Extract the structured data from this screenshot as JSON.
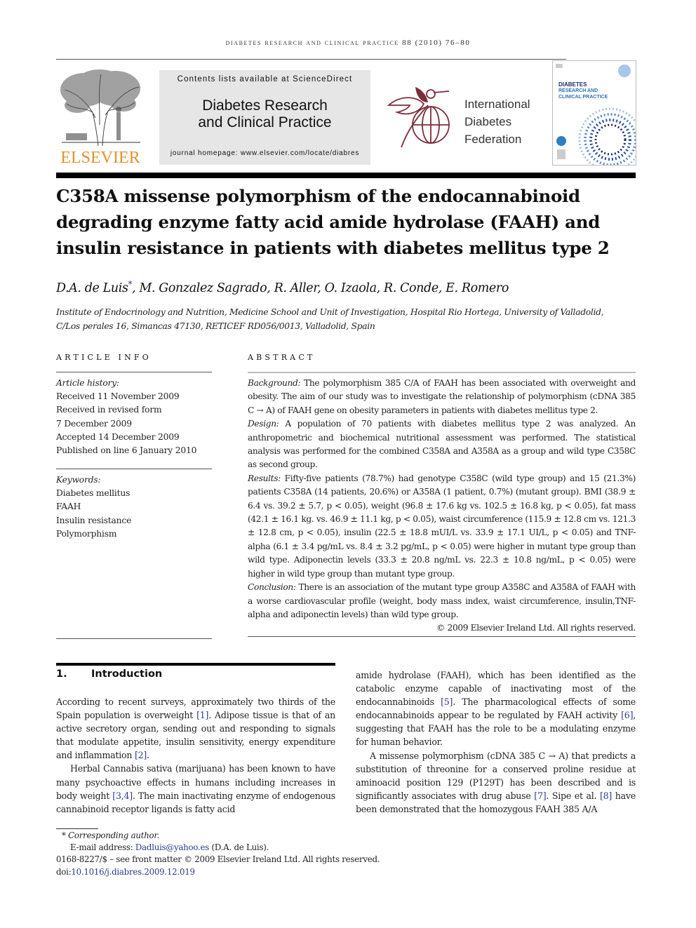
{
  "running_head": "DIABETES RESEARCH AND CLINICAL PRACTICE 88 (2010) 76–80",
  "masthead": {
    "publisher_logo": "ELSEVIER",
    "sciencedirect": "Contents lists available at ScienceDirect",
    "journal_title_line1": "Diabetes Research",
    "journal_title_line2": "and Clinical Practice",
    "homepage_label": "journal homepage: ",
    "homepage_url": "www.elsevier.com/locate/diabres",
    "idf_line1": "International",
    "idf_line2": "Diabetes",
    "idf_line3": "Federation",
    "cover_line1": "DIABETES",
    "cover_line2": "RESEARCH AND",
    "cover_line3": "CLINICAL PRACTICE"
  },
  "article": {
    "title": "C358A missense polymorphism of the endocannabinoid degrading enzyme fatty acid amide hydrolase (FAAH) and insulin resistance in patients with diabetes mellitus type 2",
    "first_author": "D.A. de Luis",
    "star": "*",
    "other_authors": ", M. Gonzalez Sagrado, R. Aller, O. Izaola, R. Conde, E. Romero",
    "affiliation_line1": "Institute of Endocrinology and Nutrition, Medicine School and Unit of Investigation, Hospital Rio Hortega, University of Valladolid,",
    "affiliation_line2": "C/Los perales 16, Simancas 47130, RETICEF RD056/0013, Valladolid, Spain"
  },
  "article_info": {
    "heading": "ARTICLE INFO",
    "history_label": "Article history:",
    "history": [
      "Received 11 November 2009",
      "Received in revised form",
      "7 December 2009",
      "Accepted 14 December 2009",
      "Published on line 6 January 2010"
    ],
    "keywords_label": "Keywords:",
    "keywords": [
      "Diabetes mellitus",
      "FAAH",
      "Insulin resistance",
      "Polymorphism"
    ]
  },
  "abstract": {
    "heading": "ABSTRACT",
    "background_label": "Background:",
    "background": "The polymorphism 385 C/A of FAAH has been associated with overweight and obesity. The aim of our study was to investigate the relationship of polymorphism (cDNA 385 C → A) of FAAH gene on obesity parameters in patients with diabetes mellitus type 2.",
    "design_label": "Design:",
    "design": "A population of 70 patients with diabetes mellitus type 2 was analyzed. An anthropometric and biochemical nutritional assessment was performed. The statistical analysis was performed for the combined C358A and A358A as a group and wild type C358C as second group.",
    "results_label": "Results:",
    "results": "Fifty-five patients (78.7%) had genotype C358C (wild type group) and 15 (21.3%) patients C358A (14 patients, 20.6%) or A358A (1 patient, 0.7%) (mutant group). BMI (38.9 ± 6.4 vs. 39.2 ± 5.7, p < 0.05), weight (96.8 ± 17.6 kg vs. 102.5 ± 16.8 kg, p < 0.05), fat mass (42.1 ± 16.1 kg. vs. 46.9 ± 11.1 kg, p < 0.05), waist circumference (115.9 ± 12.8 cm vs. 121.3 ± 12.8 cm, p < 0.05), insulin (22.5 ± 18.8 mUI/L vs. 33.9 ± 17.1 UI/L, p < 0.05) and TNF-alpha (6.1 ± 3.4 pg/mL vs. 8.4 ± 3.2 pg/mL, p < 0.05) were higher in mutant type group than wild type. Adiponectin levels (33.3 ± 20.8 ng/mL vs. 22.3 ± 10.8 ng/mL, p < 0.05) were higher in wild type group than mutant type group.",
    "conclusion_label": "Conclusion:",
    "conclusion": "There is an association of the mutant type group A358C and A358A of FAAH with a worse cardiovascular profile (weight, body mass index, waist circumference, insulin,TNF-alpha and adiponectin levels) than wild type group.",
    "copyright": "© 2009 Elsevier Ireland Ltd. All rights reserved."
  },
  "introduction": {
    "number": "1.",
    "heading": "Introduction",
    "left": {
      "p1_a": "According to recent surveys, approximately two thirds of the Spain population is overweight ",
      "p1_ref1": "[1]",
      "p1_b": ". Adipose tissue is that of an active secretory organ, sending out and responding to signals that modulate appetite, insulin sensitivity, energy expenditure and inflammation ",
      "p1_ref2": "[2]",
      "p1_c": ".",
      "p2_a": "Herbal Cannabis sativa (marijuana) has been known to have many psychoactive effects in humans including increases in body weight ",
      "p2_ref": "[3,4]",
      "p2_b": ". The main inactivating enzyme of endogenous cannabinoid receptor ligands is fatty acid"
    },
    "right": {
      "p1_a": "amide hydrolase (FAAH), which has been identified as the catabolic enzyme capable of inactivating most of the endocannabinoids ",
      "p1_ref1": "[5]",
      "p1_b": ". The pharmacological effects of some endocannabinoids appear to be regulated by FAAH activity ",
      "p1_ref2": "[6]",
      "p1_c": ", suggesting that FAAH has the role to be a modulating enzyme for human behavior.",
      "p2_a": "A missense polymorphism (cDNA 385 C → A) that predicts a substitution of threonine for a conserved proline residue at aminoacid position 129 (P129T) has been described and is significantly associates with drug abuse ",
      "p2_ref1": "[7]",
      "p2_b": ". Sipe et al. ",
      "p2_ref2": "[8]",
      "p2_c": " have been demonstrated that the homozygous FAAH 385 A/A"
    }
  },
  "footnotes": {
    "star": "*",
    "corresponding": "Corresponding author.",
    "email_label": "E-mail address: ",
    "email": "Dadluis@yahoo.es",
    "email_suffix": " (D.A. de Luis).",
    "front_matter": "0168-8227/$ – see front matter © 2009 Elsevier Ireland Ltd. All rights reserved.",
    "doi_label": "doi:",
    "doi": "10.1016/j.diabres.2009.12.019"
  },
  "colors": {
    "elsevier_orange": "#e8902e",
    "idf_maroon": "#7a2e3a",
    "link_blue": "#2b3a8f",
    "masthead_grey": "#e6e6e6"
  }
}
